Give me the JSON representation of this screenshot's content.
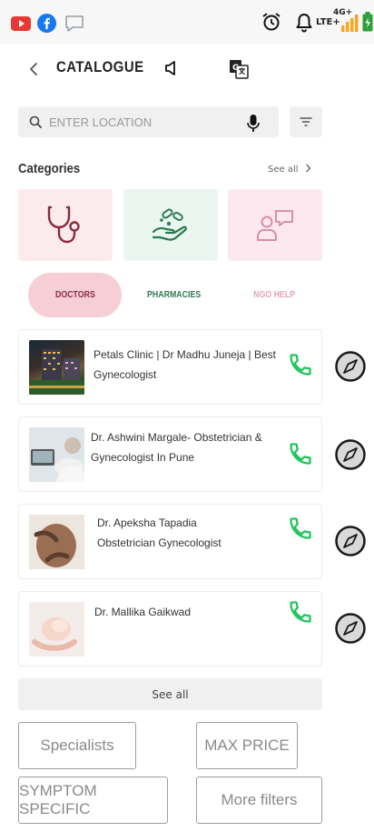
{
  "status_bar": {
    "network_gen": "4G+",
    "network_type": "LTE+",
    "icons": [
      "youtube-icon",
      "facebook-icon",
      "message-icon",
      "alarm-icon",
      "bell-icon",
      "signal-icon",
      "battery-icon"
    ]
  },
  "header": {
    "title": "CATALOGUE"
  },
  "search": {
    "placeholder": "ENTER LOCATION"
  },
  "categories": {
    "title": "Categories",
    "see_all": "See all",
    "cards": [
      {
        "icon": "stethoscope-icon",
        "bg": "#fcebec",
        "color": "#8a2b3e"
      },
      {
        "icon": "hand-pills-icon",
        "bg": "#eaf6ef",
        "color": "#2e7a52"
      },
      {
        "icon": "person-chat-icon",
        "bg": "#fbe9ef",
        "color": "#d98fa9"
      }
    ]
  },
  "tabs": [
    {
      "label": "DOCTORS",
      "color": "#8a2b3e",
      "bg": "#f6cfd6",
      "active": true
    },
    {
      "label": "PHARMACIES",
      "color": "#2e7a52",
      "active": false
    },
    {
      "label": "NGO HELP",
      "color": "#e4a3ba",
      "active": false
    }
  ],
  "results": [
    {
      "line1": "Petals Clinic | Dr Madhu Juneja | Best",
      "line2": "Gynecologist"
    },
    {
      "line1": "Dr. Ashwini Margale- Obstetrician &",
      "line2": "Gynecologist In Pune"
    },
    {
      "line1": "Dr. Apeksha Tapadia",
      "line2": "Obstetrician Gynecologist"
    },
    {
      "line1": "Dr. Mallika Gaikwad",
      "line2": ""
    }
  ],
  "see_all_button": "See all",
  "filters": {
    "specialists": "Specialists",
    "max_price": "MAX PRICE",
    "symptom_specific": "SYMPTOM SPECIFIC",
    "more_filters": "More filters"
  },
  "colors": {
    "call_green": "#22c55e",
    "accent_maroon": "#8a2b3e"
  }
}
